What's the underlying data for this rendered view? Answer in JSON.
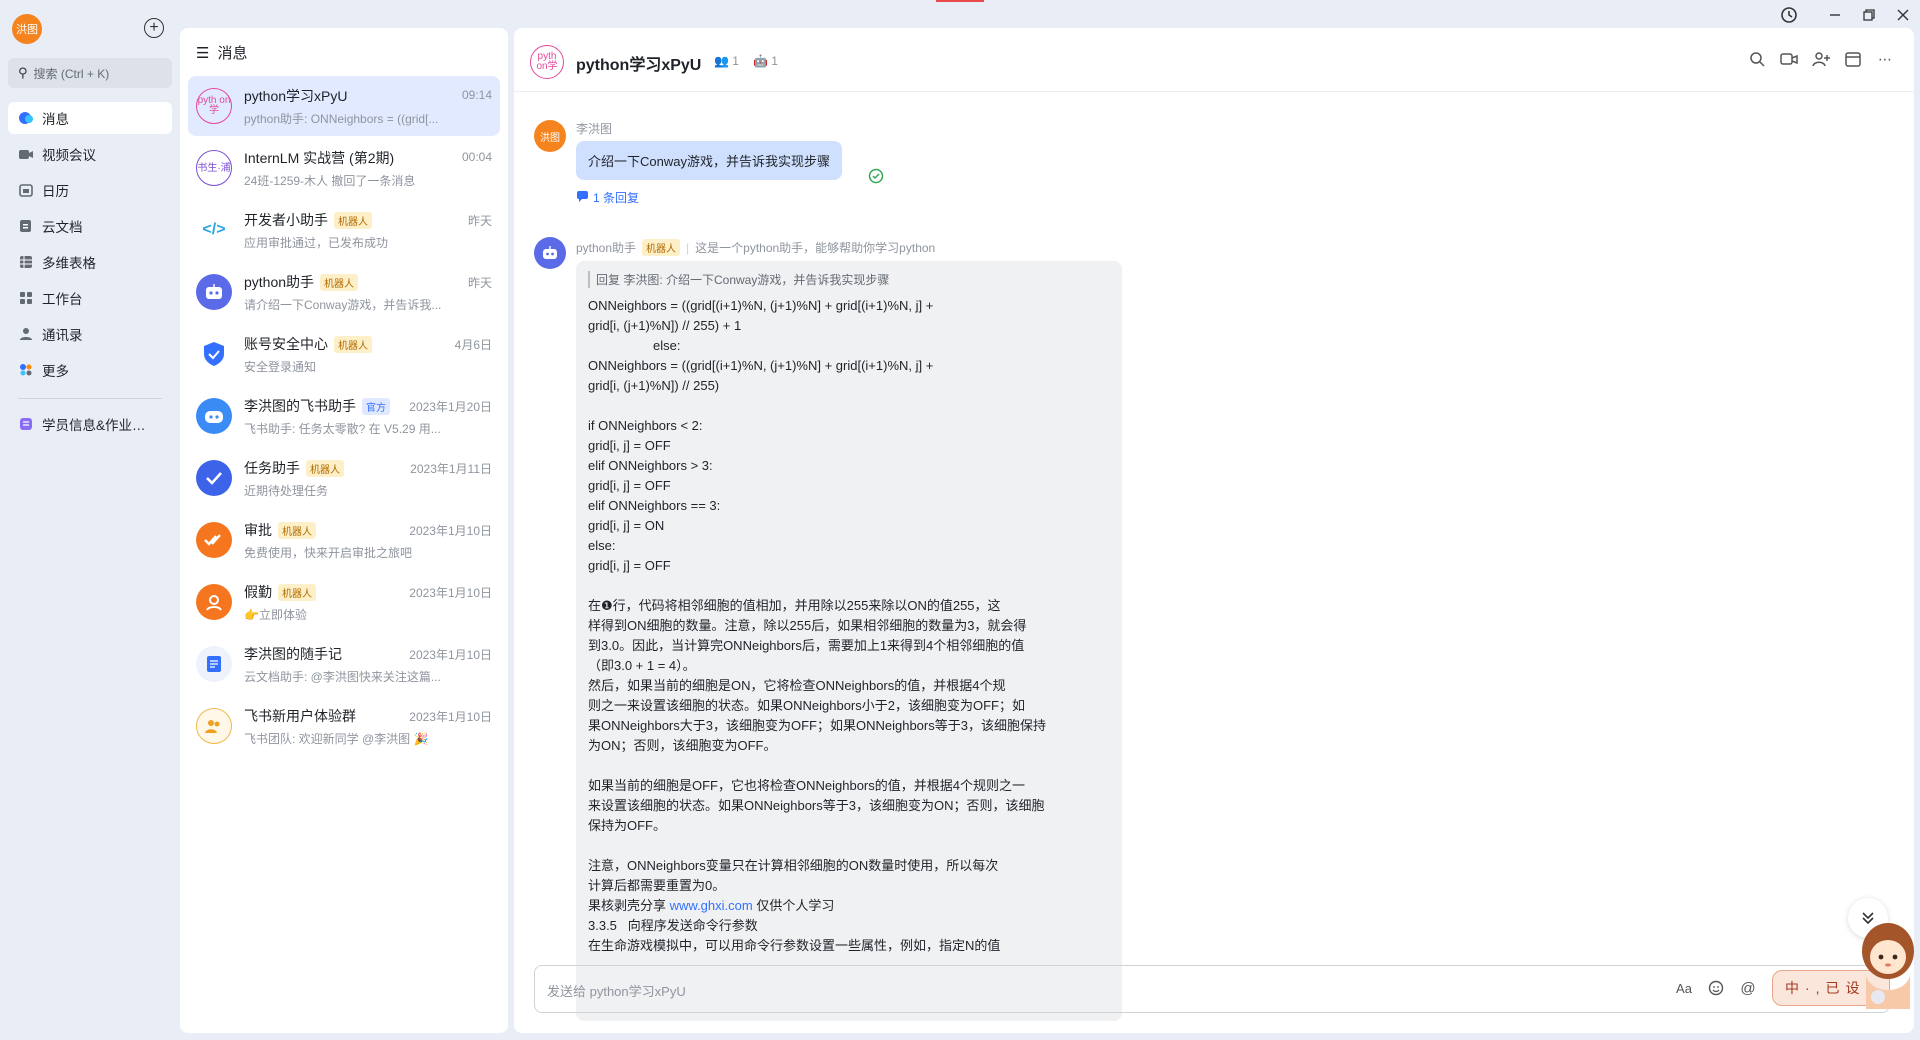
{
  "user": {
    "avatar_text": "洪图"
  },
  "nav": {
    "search_placeholder": "搜索 (Ctrl + K)",
    "items": [
      {
        "label": "消息",
        "icon": "chat-bubble-icon"
      },
      {
        "label": "视频会议",
        "icon": "video-icon"
      },
      {
        "label": "日历",
        "icon": "calendar-icon"
      },
      {
        "label": "云文档",
        "icon": "cloud-doc-icon"
      },
      {
        "label": "多维表格",
        "icon": "table-icon"
      },
      {
        "label": "工作台",
        "icon": "grid-icon"
      },
      {
        "label": "通讯录",
        "icon": "contacts-icon"
      },
      {
        "label": "更多",
        "icon": "more-apps-icon"
      },
      {
        "label": "学员信息&作业…",
        "icon": "form-icon"
      }
    ]
  },
  "chatlist": {
    "header": "消息",
    "items": [
      {
        "name": "python学习xPyU",
        "time": "09:14",
        "preview": "python助手: ONNeighbors = ((grid[...",
        "tag": "",
        "avatar_text": "pyth on学"
      },
      {
        "name": "InternLM 实战营 (第2期)",
        "time": "00:04",
        "preview": "24班-1259-木人 撤回了一条消息",
        "tag": "",
        "avatar_text": "书生·浦"
      },
      {
        "name": "开发者小助手",
        "time": "昨天",
        "preview": "应用审批通过，已发布成功",
        "tag": "机器人",
        "avatar_text": "</>"
      },
      {
        "name": "python助手",
        "time": "昨天",
        "preview": "请介绍一下Conway游戏，并告诉我...",
        "tag": "机器人",
        "avatar_text": ""
      },
      {
        "name": "账号安全中心",
        "time": "4月6日",
        "preview": "安全登录通知",
        "tag": "机器人",
        "avatar_text": ""
      },
      {
        "name": "李洪图的飞书助手",
        "time": "2023年1月20日",
        "preview": "飞书助手: 任务太零散? 在 V5.29 用...",
        "tag": "官方",
        "avatar_text": ""
      },
      {
        "name": "任务助手",
        "time": "2023年1月11日",
        "preview": "近期待处理任务",
        "tag": "机器人",
        "avatar_text": ""
      },
      {
        "name": "审批",
        "time": "2023年1月10日",
        "preview": "免费使用，快来开启审批之旅吧",
        "tag": "机器人",
        "avatar_text": ""
      },
      {
        "name": "假勤",
        "time": "2023年1月10日",
        "preview": "👉立即体验",
        "tag": "机器人",
        "avatar_text": ""
      },
      {
        "name": "李洪图的随手记",
        "time": "2023年1月10日",
        "preview": "云文档助手: @李洪图快来关注这篇...",
        "tag": "",
        "avatar_text": ""
      },
      {
        "name": "飞书新用户体验群",
        "time": "2023年1月10日",
        "preview": "飞书团队: 欢迎新同学 @李洪图 🎉",
        "tag": "",
        "avatar_text": ""
      }
    ]
  },
  "conversation": {
    "title": "python学习xPyU",
    "member_count": "1",
    "bot_count": "1",
    "msg1": {
      "sender": "李洪图",
      "avatar_text": "洪图",
      "text": "介绍一下Conway游戏，并告诉我实现步骤",
      "reply_count": "1 条回复"
    },
    "msg2": {
      "sender": "python助手",
      "tag": "机器人",
      "signature": "这是一个python助手，能够帮助你学习python",
      "quote": "回复 李洪图: 介绍一下Conway游戏，并告诉我实现步骤",
      "lines": [
        "ONNeighbors = ((grid[(i+1)%N, (j+1)%N] + grid[(i+1)%N, j] +",
        "grid[i, (j+1)%N]) // 255) + 1",
        "                  else:",
        "ONNeighbors = ((grid[(i+1)%N, (j+1)%N] + grid[(i+1)%N, j] +",
        "grid[i, (j+1)%N]) // 255)",
        "",
        "if ONNeighbors < 2:",
        "grid[i, j] = OFF",
        "elif ONNeighbors > 3:",
        "grid[i, j] = OFF",
        "elif ONNeighbors == 3:",
        "grid[i, j] = ON",
        "else:",
        "grid[i, j] = OFF",
        "",
        "在❶行，代码将相邻细胞的值相加，并用除以255来除以ON的值255，这",
        "样得到ON细胞的数量。注意，除以255后，如果相邻细胞的数量为3，就会得",
        "到3.0。因此，当计算完ONNeighbors后，需要加上1来得到4个相邻细胞的值",
        "（即3.0 + 1 = 4）。",
        "然后，如果当前的细胞是ON，它将检查ONNeighbors的值，并根据4个规",
        "则之一来设置该细胞的状态。如果ONNeighbors小于2，该细胞变为OFF；如",
        "果ONNeighbors大于3，该细胞变为OFF；如果ONNeighbors等于3，该细胞保持",
        "为ON；否则，该细胞变为OFF。",
        "",
        "如果当前的细胞是OFF，它也将检查ONNeighbors的值，并根据4个规则之一",
        "来设置该细胞的状态。如果ONNeighbors等于3，该细胞变为ON；否则，该细胞",
        "保持为OFF。",
        "",
        "注意，ONNeighbors变量只在计算相邻细胞的ON数量时使用，所以每次",
        "计算后都需要重置为0。"
      ],
      "footer_prefix": "果核剥壳分享 ",
      "footer_link": "www.ghxi.com",
      "footer_suffix": " 仅供个人学习",
      "tail_lines": [
        "3.3.5   向程序发送命令行参数",
        "在生命游戏模拟中，可以用命令行参数设置一些属性，例如，指定N的值"
      ]
    },
    "input_placeholder": "发送给 python学习xPyU"
  },
  "ime": {
    "text": "中·,已设"
  },
  "colors": {
    "accent": "#3370ff",
    "bubble_self": "#cfe0ff",
    "avatar_orange": "#f5841f"
  }
}
